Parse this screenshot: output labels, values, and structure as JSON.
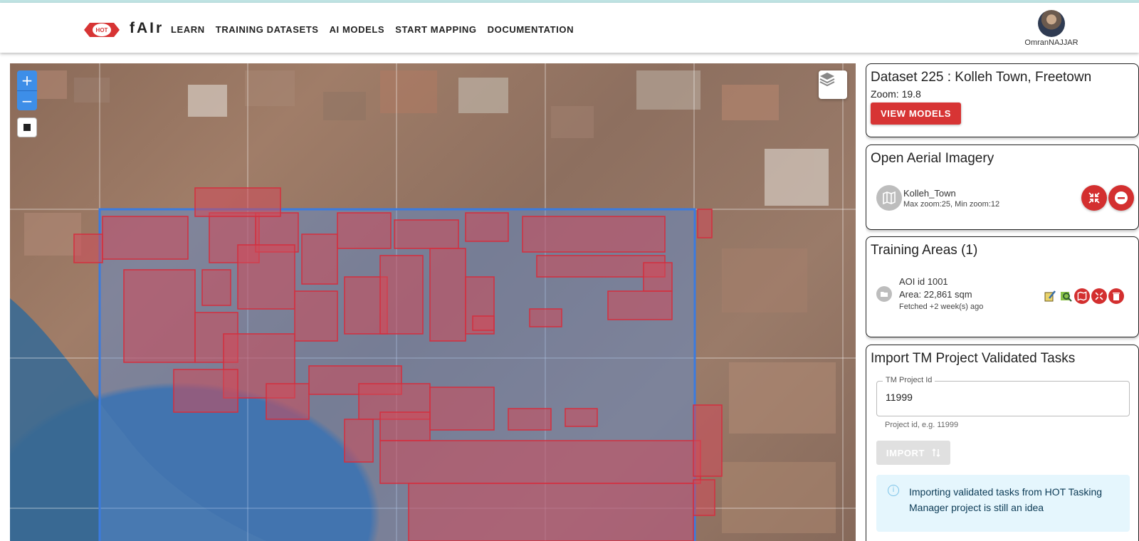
{
  "app": {
    "brand": "fAIr",
    "logo_text": "HOT"
  },
  "nav": {
    "items": [
      "LEARN",
      "TRAINING DATASETS",
      "AI MODELS",
      "START MAPPING",
      "DOCUMENTATION"
    ]
  },
  "user": {
    "name": "OmranNAJJAR"
  },
  "map": {
    "zoom_in": "+",
    "zoom_out": "−"
  },
  "dataset": {
    "title": "Dataset 225 : Kolleh Town, Freetown",
    "zoom_text": "Zoom: 19.8",
    "view_models_label": "VIEW MODELS"
  },
  "imagery": {
    "title": "Open Aerial Imagery",
    "item_name": "Kolleh_Town",
    "item_sub": "Max zoom:25, Min zoom:12"
  },
  "training_areas": {
    "title": "Training Areas (1)",
    "aoi_id": "AOI id 1001",
    "area": "Area: 22,861 sqm",
    "fetched": "Fetched +2 week(s) ago"
  },
  "import_tm": {
    "title": "Import TM Project Validated Tasks",
    "field_label": "TM Project Id",
    "field_value": "11999",
    "helper": "Project id, e.g. 11999",
    "import_label": "IMPORT",
    "info": "Importing validated tasks from HOT Tasking Manager project is still an idea"
  },
  "colors": {
    "accent_red": "#d73434",
    "map_blue": "#3d8ee8",
    "polygon_red": "#d32f3f"
  }
}
